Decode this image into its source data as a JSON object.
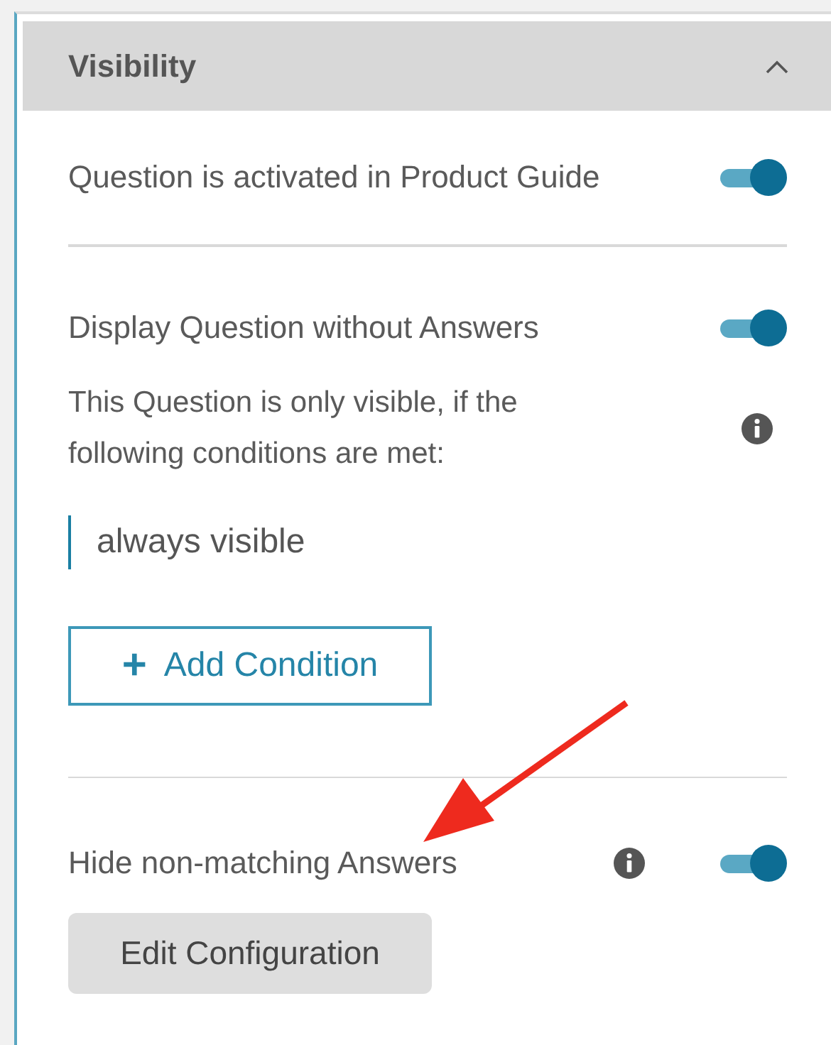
{
  "section": {
    "title": "Visibility",
    "expanded": true
  },
  "activated": {
    "label": "Question is activated in Product Guide",
    "on": true
  },
  "display_without_answers": {
    "label": "Display Question without Answers",
    "on": true
  },
  "condition_note": "This Question is only visible, if the following conditions are met:",
  "conditions": [
    "always visible"
  ],
  "add_condition_button": {
    "icon": "+",
    "label": "Add Condition"
  },
  "hide_non_matching": {
    "label": "Hide non-matching Answers",
    "on": true
  },
  "edit_configuration_button": "Edit Configuration"
}
